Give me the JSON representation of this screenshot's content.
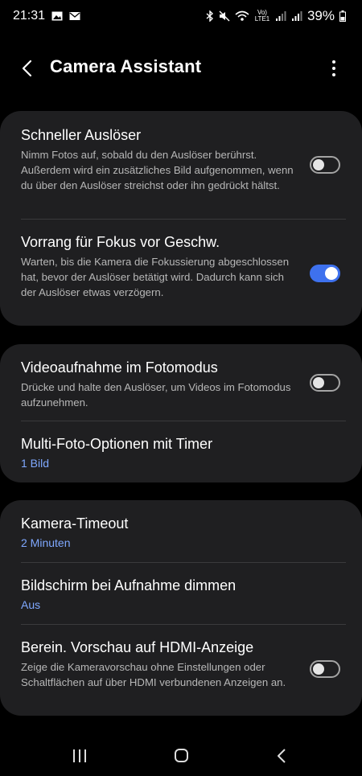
{
  "status_bar": {
    "time": "21:31",
    "network": "LTE1",
    "battery": "39%",
    "icons": [
      "gallery-icon",
      "mail-icon",
      "bluetooth-icon",
      "mute-icon",
      "wifi-icon",
      "volte-icon",
      "signal-icon",
      "signal-icon",
      "battery-icon"
    ]
  },
  "header": {
    "title": "Camera Assistant",
    "back_icon": "back-arrow-icon",
    "menu_icon": "more-options-icon"
  },
  "cards": [
    {
      "items": [
        {
          "title": "Schneller Auslöser",
          "description": "Nimm Fotos auf, sobald du den Auslöser berührst. Außerdem wird ein zusätzliches Bild aufgenommen, wenn du über den Auslöser streichst oder ihn gedrückt hältst.",
          "toggle": false
        },
        {
          "title": "Vorrang für Fokus vor Geschw.",
          "description": "Warten, bis die Kamera die Fokussierung abgeschlossen hat, bevor der Auslöser betätigt wird. Dadurch kann sich der Auslöser etwas verzögern.",
          "toggle": true
        }
      ]
    },
    {
      "items": [
        {
          "title": "Videoaufnahme im Fotomodus",
          "description": "Drücke und halte den Auslöser, um Videos im Fotomodus aufzunehmen.",
          "toggle": false
        },
        {
          "title": "Multi-Foto-Optionen mit Timer",
          "value": "1 Bild"
        }
      ]
    },
    {
      "items": [
        {
          "title": "Kamera-Timeout",
          "value": "2 Minuten"
        },
        {
          "title": "Bildschirm bei Aufnahme dimmen",
          "value": "Aus"
        },
        {
          "title": "Berein. Vorschau auf HDMI-Anzeige",
          "description": "Zeige die Kameravorschau ohne Einstellungen oder Schaltflächen auf über HDMI verbundenen Anzeigen an.",
          "toggle": false
        }
      ]
    }
  ],
  "nav_bar": {
    "icons": [
      "recent-apps-icon",
      "home-icon",
      "back-icon"
    ]
  },
  "colors": {
    "background": "#000000",
    "card": "#1f1f21",
    "accent": "#3e71ee",
    "value_text": "#7fa8ff",
    "secondary_text": "#b7b7b7"
  }
}
